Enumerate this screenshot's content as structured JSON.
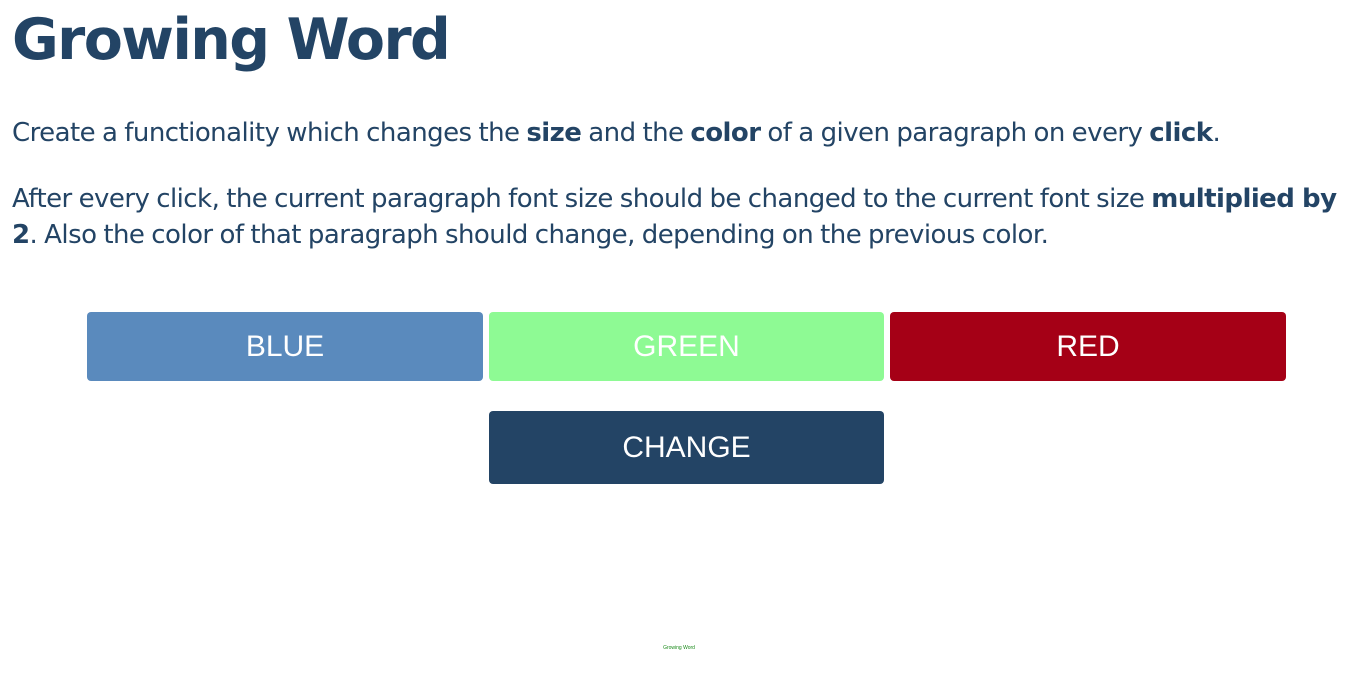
{
  "page": {
    "title": "Growing Word"
  },
  "description": {
    "p1": {
      "t1": "Create a functionality which changes the ",
      "b1": "size",
      "t2": " and the ",
      "b2": "color",
      "t3": " of a given paragraph on every ",
      "b3": "click",
      "t4": "."
    },
    "p2": {
      "t1": "After every click, the current paragraph font size should be changed to the current font size ",
      "b1": "multiplied by 2",
      "t2": ". Also the color of that paragraph should change, depending on the previous color."
    }
  },
  "color_buttons": [
    {
      "label": "BLUE",
      "color": "#5a8abd"
    },
    {
      "label": "GREEN",
      "color": "#8efa94"
    },
    {
      "label": "RED",
      "color": "#a50016"
    }
  ],
  "change_button": {
    "label": "CHANGE",
    "color": "#234465"
  },
  "growing_word": {
    "text": "Growing Word",
    "color": "#1a8a1a"
  },
  "colors": {
    "text": "#234465",
    "background": "#ffffff"
  }
}
